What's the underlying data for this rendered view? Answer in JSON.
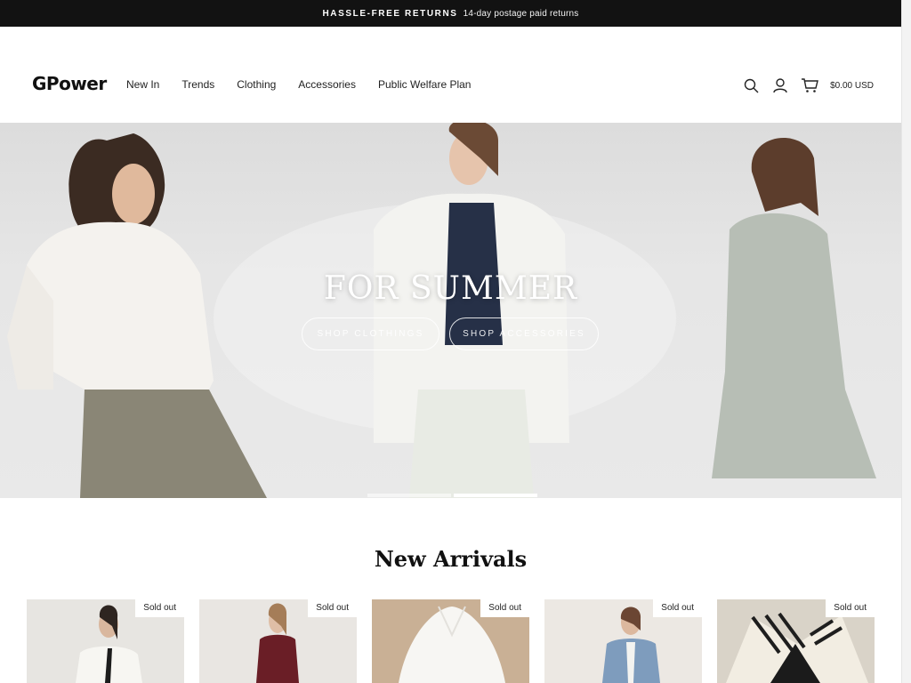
{
  "announcement": {
    "strong": "HASSLE-FREE RETURNS",
    "text": "14-day postage paid returns"
  },
  "header": {
    "logo": "GPower",
    "nav": [
      "New In",
      "Trends",
      "Clothing",
      "Accessories",
      "Public Welfare Plan"
    ],
    "cart_total": "$0.00 USD",
    "icons": [
      "search-icon",
      "account-icon",
      "cart-icon"
    ]
  },
  "hero": {
    "title": "FOR SUMMER",
    "buttons": [
      "SHOP CLOTHINGS",
      "SHOP ACCESSORIES"
    ],
    "slides": 2,
    "active_slide": 2
  },
  "new_arrivals": {
    "title": "New Arrivals",
    "products": [
      {
        "badge": "Sold out"
      },
      {
        "badge": "Sold out"
      },
      {
        "badge": "Sold out"
      },
      {
        "badge": "Sold out"
      },
      {
        "badge": "Sold out"
      }
    ]
  }
}
